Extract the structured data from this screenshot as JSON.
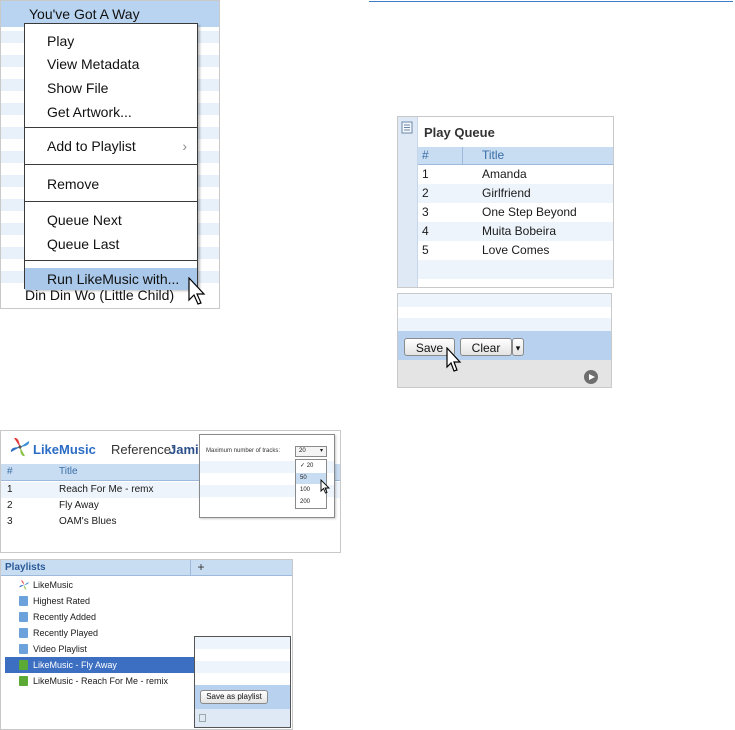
{
  "context_menu_panel": {
    "song_top": "You've Got A Way",
    "song_bottom": "Din Din Wo (Little Child)",
    "menu_items": [
      {
        "label": "Play"
      },
      {
        "label": "View Metadata"
      },
      {
        "label": "Show File"
      },
      {
        "label": "Get Artwork..."
      },
      {
        "label": "Add to Playlist",
        "submenu": "›"
      },
      {
        "label": "Remove"
      },
      {
        "label": "Queue Next"
      },
      {
        "label": "Queue Last"
      },
      {
        "label": "Run LikeMusic with..."
      }
    ],
    "highlight_color": "#a9c8ea"
  },
  "play_queue": {
    "title": "Play Queue",
    "columns": [
      "#",
      "Title"
    ],
    "rows": [
      {
        "n": "1",
        "title": "Amanda"
      },
      {
        "n": "2",
        "title": "Girlfriend"
      },
      {
        "n": "3",
        "title": "One Step Beyond"
      },
      {
        "n": "4",
        "title": "Muita Bobeira"
      },
      {
        "n": "5",
        "title": "Love Comes"
      }
    ]
  },
  "queue_actions": {
    "save_label": "Save",
    "clear_label": "Clear",
    "dropdown_arrow": "▾"
  },
  "likemusic": {
    "app_name": "LikeMusic",
    "reference_label": "Reference:",
    "reference_value": "Jamie",
    "columns": [
      "#",
      "Title"
    ],
    "rows": [
      {
        "n": "1",
        "title": "Reach For Me - remx"
      },
      {
        "n": "2",
        "title": "Fly Away"
      },
      {
        "n": "3",
        "title": "OAM's Blues"
      }
    ],
    "max_tracks_label": "Maximum number of tracks:",
    "max_tracks_selected": "20",
    "max_tracks_options": [
      "✓ 20",
      "50",
      "100",
      "200"
    ]
  },
  "playlists": {
    "header": "Playlists",
    "add_label": "+",
    "items": [
      {
        "label": "LikeMusic",
        "icon": "likemusic-logo-icon"
      },
      {
        "label": "Highest Rated",
        "icon": "smart-playlist-icon"
      },
      {
        "label": "Recently Added",
        "icon": "smart-playlist-icon"
      },
      {
        "label": "Recently Played",
        "icon": "smart-playlist-icon"
      },
      {
        "label": "Video Playlist",
        "icon": "smart-playlist-icon"
      },
      {
        "label": "LikeMusic - Fly Away",
        "icon": "playlist-icon",
        "selected": true
      },
      {
        "label": "LikeMusic - Reach For Me - remix",
        "icon": "playlist-icon"
      }
    ],
    "save_as_playlist_label": "Save as playlist",
    "selected_color": "#3c6ec1"
  }
}
